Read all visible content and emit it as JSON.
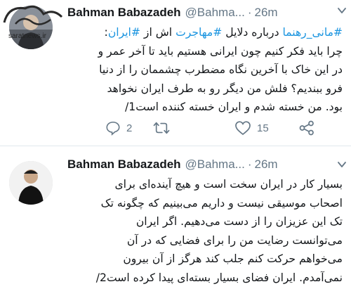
{
  "watermark": "saratnews.ir",
  "tweets": [
    {
      "author": {
        "name": "Bahman Babazadeh",
        "handle": "@Bahma...",
        "separator": "·",
        "time": "26m"
      },
      "lines": [
        [
          {
            "t": "#مانی_رهنما",
            "h": true
          },
          {
            "t": " درباره دلایل ",
            "h": false
          },
          {
            "t": "#مهاجرت",
            "h": true
          },
          {
            "t": " اش از ",
            "h": false
          },
          {
            "t": "#ایران",
            "h": true
          },
          {
            "t": ":",
            "h": false
          }
        ],
        [
          {
            "t": "چرا باید فکر کنیم چون ایرانی هستیم باید تا آخر عمر و",
            "h": false
          }
        ],
        [
          {
            "t": "در این خاک با آخرین نگاه مضطرب چشممان را از دنیا",
            "h": false
          }
        ],
        [
          {
            "t": "فرو ببندیم؟ فلش من دیگر رو به طرف ایران نخواهد",
            "h": false
          }
        ],
        [
          {
            "t": "بود. من خسته شدم و ایران خسته کننده است1/",
            "h": false
          }
        ]
      ],
      "actions": {
        "reply_count": "2",
        "retweet_count": "",
        "like_count": "15"
      }
    },
    {
      "author": {
        "name": "Bahman Babazadeh",
        "handle": "@Bahma...",
        "separator": "·",
        "time": "26m"
      },
      "lines": [
        [
          {
            "t": "بسیار کار در ایران سخت است و هیچ آینده‌ای برای",
            "h": false
          }
        ],
        [
          {
            "t": "اصحاب موسیقی نیست و داریم می‌بینیم که چگونه تک",
            "h": false
          }
        ],
        [
          {
            "t": "تک این عزیزان را از دست می‌دهیم. اگر ایران",
            "h": false
          }
        ],
        [
          {
            "t": "می‌توانست رضایت من را برای فضایی که در آن",
            "h": false
          }
        ],
        [
          {
            "t": "می‌خواهم حرکت کنم جلب کند هرگز از آن بیرون",
            "h": false
          }
        ],
        [
          {
            "t": "نمی‌آمدم. ایران فضای بسیار بسته‌ای پیدا کرده است2/",
            "h": false
          }
        ]
      ]
    }
  ],
  "colors": {
    "hashtag": "#1b95e0",
    "muted": "#657786",
    "text": "#14171a"
  },
  "icons": [
    "reply-icon",
    "retweet-icon",
    "like-icon",
    "share-icon",
    "caret-down-icon"
  ]
}
